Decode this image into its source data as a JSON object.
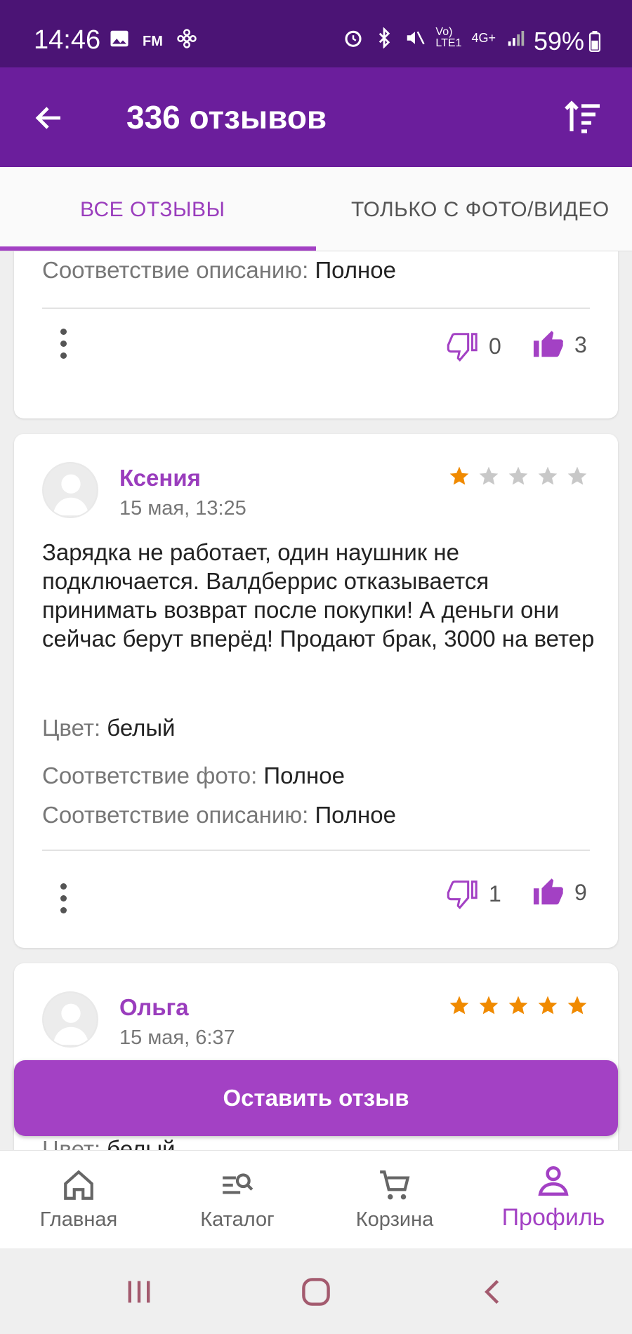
{
  "status_bar": {
    "time": "14:46",
    "battery": "59%",
    "network": "4G+"
  },
  "app_bar": {
    "title": "336 отзывов",
    "back_icon": "arrow-left-icon",
    "sort_icon": "sort-icon"
  },
  "tabs": [
    {
      "label": "ВСЕ ОТЗЫВЫ",
      "active": true
    },
    {
      "label": "ТОЛЬКО С ФОТО/ВИДЕО",
      "active": false
    }
  ],
  "colors": {
    "accent": "#a341c4",
    "app_bar": "#6b1e9c",
    "status_bar": "#4b1475",
    "star_active": "#f08a00",
    "star_inactive": "#c8c8c8"
  },
  "reviews": [
    {
      "attributes": [
        {
          "label": "Соответствие описанию:",
          "value": "Полное"
        }
      ],
      "dislikes": "0",
      "likes": "3"
    },
    {
      "author": "Ксения",
      "date": "15 мая, 13:25",
      "rating": 1,
      "text": "Зарядка не работает, один наушник не подключается. Валдберрис отказывается принимать возврат после покупки! А деньги они сейчас берут вперёд! Продают брак, 3000 на ветер",
      "attributes": [
        {
          "label": "Цвет:",
          "value": "белый"
        },
        {
          "label": "Соответствие фото:",
          "value": "Полное"
        },
        {
          "label": "Соответствие описанию:",
          "value": "Полное"
        }
      ],
      "dislikes": "1",
      "likes": "9"
    },
    {
      "author": "Ольга",
      "date": "15 мая, 6:37",
      "rating": 5
    }
  ],
  "leave_review_button": "Оставить отзыв",
  "bottom_nav": [
    {
      "label": "Главная",
      "icon": "home-icon",
      "active": false
    },
    {
      "label": "Каталог",
      "icon": "catalog-search-icon",
      "active": false
    },
    {
      "label": "Корзина",
      "icon": "cart-icon",
      "active": false
    },
    {
      "label": "Профиль",
      "icon": "profile-icon",
      "active": true
    }
  ]
}
